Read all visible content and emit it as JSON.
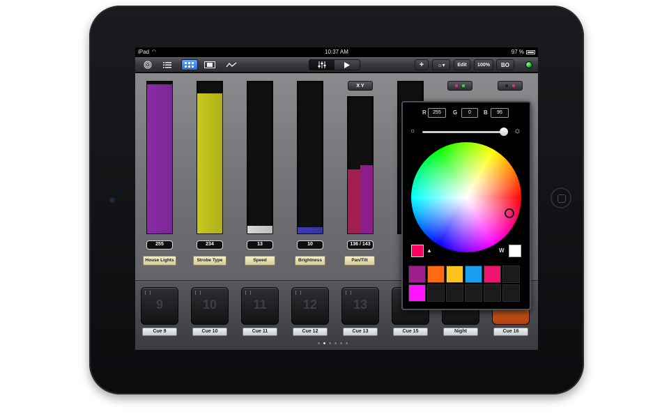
{
  "status": {
    "carrier": "iPad",
    "time": "10:37 AM",
    "battery": "97 %"
  },
  "toolbar": {
    "left_icons": [
      "target-icon",
      "list-icon",
      "grid-icon",
      "film-icon",
      "wave-icon"
    ],
    "active_view": "grid",
    "segment_left_icon": "sliders-icon",
    "segment_right_icon": "play-icon",
    "add_label": "+",
    "brightness_label": "☼▾",
    "edit_label": "Edit",
    "percent_label": "100%",
    "bo_label": "BO",
    "status_color": "#22c23a"
  },
  "faders": [
    {
      "value": "255",
      "name": "House Lights",
      "level": 0.98,
      "color": "#8b2aa8"
    },
    {
      "value": "234",
      "name": "Strobe Type",
      "level": 0.92,
      "color": "#c8c81e"
    },
    {
      "value": "13",
      "name": "Speed",
      "level": 0.05,
      "color": "#d8d8d8"
    },
    {
      "value": "10",
      "name": "Brightness",
      "level": 0.04,
      "color": "#3c3cb4"
    },
    {
      "value": "136 / 143",
      "name": "Pan/Tilt",
      "xy_label": "X Y"
    }
  ],
  "cues": [
    {
      "number": "9",
      "label": "Cue 9"
    },
    {
      "number": "10",
      "label": "Cue 10"
    },
    {
      "number": "11",
      "label": "Cue 11"
    },
    {
      "number": "12",
      "label": "Cue 12"
    },
    {
      "number": "13",
      "label": "Cue 13"
    },
    {
      "number": "",
      "label": "Cue 15"
    },
    {
      "number": "",
      "label": "Night"
    },
    {
      "number": "",
      "label": "Cue 16"
    }
  ],
  "pager": {
    "pages": 6,
    "current": 2
  },
  "color_picker": {
    "r_label": "R",
    "r_value": "255",
    "g_label": "G",
    "g_value": "0",
    "b_label": "B",
    "b_value": "95",
    "brightness": 1.0,
    "current_color": "#ff005f",
    "white_label": "W",
    "palette": [
      "#a01e8c",
      "#ff6a14",
      "#ffc31e",
      "#19a0f0",
      "#f0146e",
      "",
      "#ff14ff",
      "",
      "",
      "",
      "",
      ""
    ]
  }
}
